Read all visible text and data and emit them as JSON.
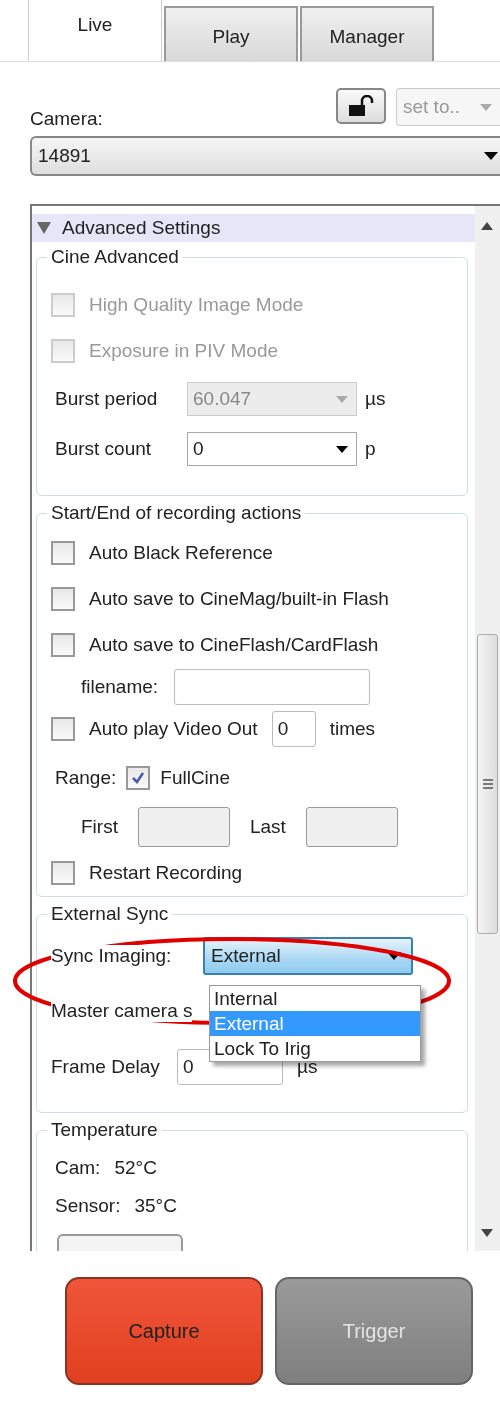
{
  "tabs": [
    {
      "label": "Live",
      "selected": true
    },
    {
      "label": "Play",
      "selected": false
    },
    {
      "label": "Manager",
      "selected": false
    }
  ],
  "preset": {
    "value": "set to..",
    "disabled": true
  },
  "camera": {
    "label": "Camera:",
    "value": "14891"
  },
  "panel": {
    "title": "Advanced Settings",
    "expanded": true
  },
  "cine_advanced": {
    "title": "Cine Advanced",
    "options": [
      {
        "label": "High Quality Image Mode",
        "checked": false,
        "disabled": true
      },
      {
        "label": "Exposure in PIV Mode",
        "checked": false,
        "disabled": true
      }
    ],
    "fields": [
      {
        "label": "Burst period",
        "value": "60.047",
        "unit": "µs",
        "disabled": true
      },
      {
        "label": "Burst count",
        "value": "0",
        "unit": "p",
        "disabled": false
      }
    ]
  },
  "recording_actions": {
    "title": "Start/End of recording actions",
    "items": [
      {
        "kind": "checkbox",
        "label": "Auto Black Reference",
        "checked": false
      },
      {
        "kind": "checkbox",
        "label": "Auto save to CineMag/built-in Flash",
        "checked": false
      },
      {
        "kind": "checkbox",
        "label": "Auto save to CineFlash/CardFlash",
        "checked": false
      },
      {
        "kind": "field",
        "label": "filename:"
      },
      {
        "kind": "repeat",
        "label": "Auto play Video Out",
        "checked": false,
        "value": "0",
        "unit": "times"
      },
      {
        "kind": "range",
        "label": "Range:",
        "option": "FullCine",
        "checked": true,
        "first": "First",
        "last": "Last"
      },
      {
        "kind": "checkbox",
        "label": "Restart Recording",
        "checked": false
      }
    ]
  },
  "external_sync": {
    "title": "External Sync",
    "sync_label": "Sync Imaging:",
    "sync_value": "External",
    "options": [
      {
        "label": "Internal",
        "selected": false
      },
      {
        "label": "External",
        "selected": true
      },
      {
        "label": "Lock To Irig",
        "selected": false
      }
    ],
    "master_label": "Master camera s",
    "delay_label": "Frame Delay",
    "delay_value": "0",
    "delay_unit": "µs"
  },
  "temperature": {
    "title": "Temperature",
    "readings": [
      {
        "label": "Cam:",
        "value": "52°C"
      },
      {
        "label": "Sensor:",
        "value": "35°C"
      }
    ]
  },
  "buttons": [
    {
      "label": "Capture",
      "disabled": false
    },
    {
      "label": "Trigger",
      "disabled": true
    }
  ]
}
